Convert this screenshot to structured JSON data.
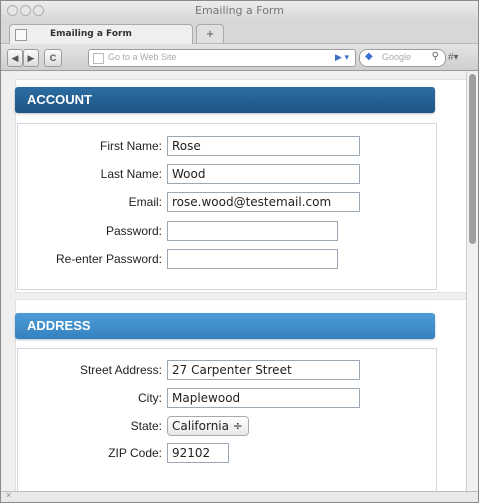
{
  "window": {
    "title": "Emailing a Form"
  },
  "tabs": [
    {
      "label": "Emailing a Form"
    }
  ],
  "toolbar": {
    "back": "◀",
    "forward": "▶",
    "reload": "C",
    "url_placeholder": "Go to a Web Site",
    "search_engine": "Google",
    "new_tab": "+"
  },
  "account": {
    "heading": "ACCOUNT",
    "fields": [
      {
        "label": "First Name:",
        "value": "Rose"
      },
      {
        "label": "Last Name:",
        "value": "Wood"
      },
      {
        "label": "Email:",
        "value": "rose.wood@testemail.com"
      },
      {
        "label": "Password:",
        "value": ""
      },
      {
        "label": "Re-enter Password:",
        "value": ""
      }
    ]
  },
  "address": {
    "heading": "ADDRESS",
    "fields": [
      {
        "label": "Street Address:",
        "value": "27 Carpenter Street"
      },
      {
        "label": "City:",
        "value": "Maplewood"
      },
      {
        "label": "State:",
        "value": "California ÷"
      },
      {
        "label": "ZIP Code:",
        "value": "92102"
      }
    ]
  },
  "colors": {
    "account_header": "#1e5485",
    "address_header": "#3582c0"
  }
}
